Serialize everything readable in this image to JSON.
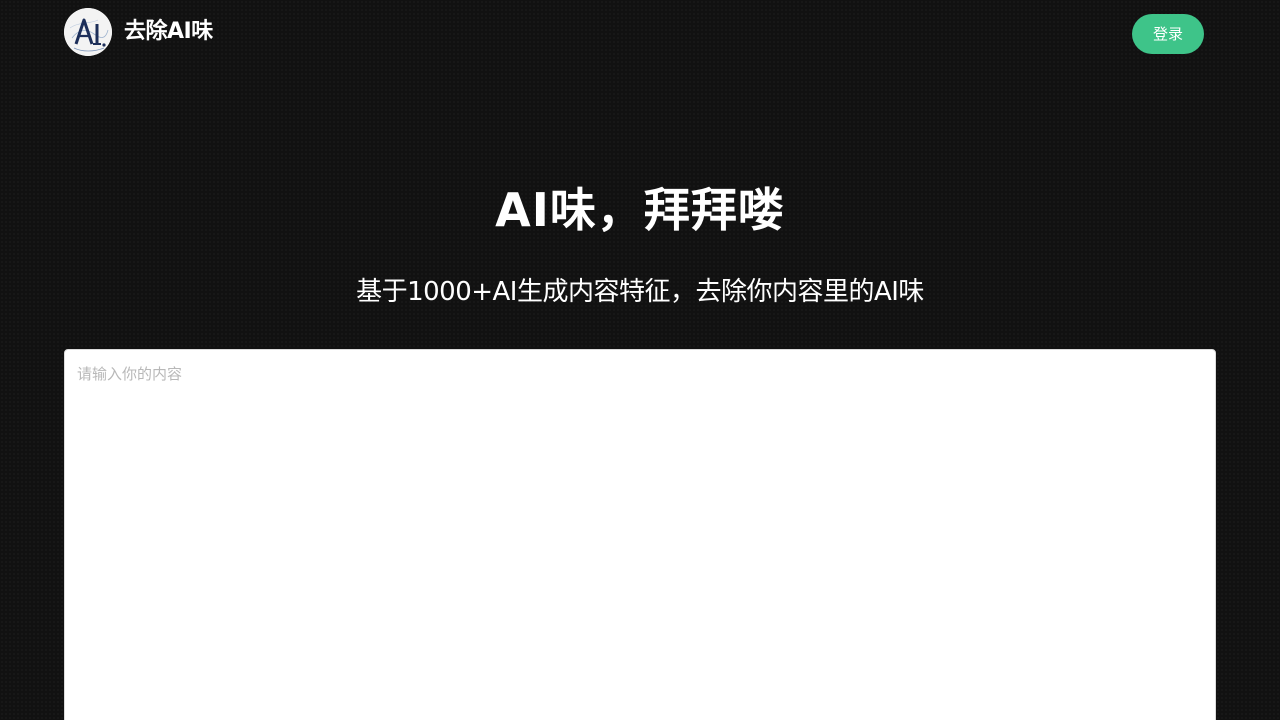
{
  "header": {
    "brand": "去除AI味",
    "logo_icon": "ai-logo-icon",
    "login_label": "登录"
  },
  "hero": {
    "title": "AI味，拜拜喽",
    "subtitle": "基于1000+AI生成内容特征，去除你内容里的AI味"
  },
  "editor": {
    "placeholder": "请输入你的内容",
    "value": ""
  },
  "colors": {
    "background": "#111111",
    "accent": "#3ec489",
    "text": "#ffffff"
  }
}
